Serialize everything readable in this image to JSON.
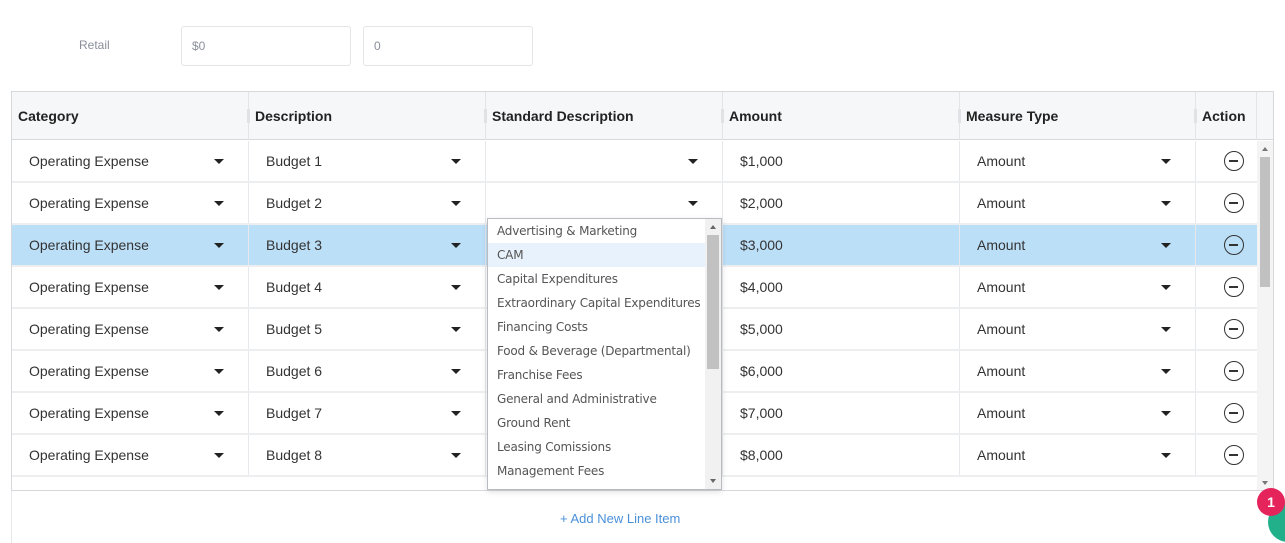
{
  "retail": {
    "label": "Retail",
    "amount_value": "$0",
    "count_value": "0"
  },
  "grid": {
    "headers": {
      "category": "Category",
      "description": "Description",
      "standard_description": "Standard Description",
      "amount": "Amount",
      "measure_type": "Measure Type",
      "action": "Action"
    },
    "rows": [
      {
        "category": "Operating Expense",
        "description": "Budget 1",
        "standard_description": "",
        "amount": "$1,000",
        "measure_type": "Amount"
      },
      {
        "category": "Operating Expense",
        "description": "Budget 2",
        "standard_description": "",
        "amount": "$2,000",
        "measure_type": "Amount"
      },
      {
        "category": "Operating Expense",
        "description": "Budget 3",
        "standard_description": "",
        "amount": "$3,000",
        "measure_type": "Amount"
      },
      {
        "category": "Operating Expense",
        "description": "Budget 4",
        "standard_description": "",
        "amount": "$4,000",
        "measure_type": "Amount"
      },
      {
        "category": "Operating Expense",
        "description": "Budget 5",
        "standard_description": "",
        "amount": "$5,000",
        "measure_type": "Amount"
      },
      {
        "category": "Operating Expense",
        "description": "Budget 6",
        "standard_description": "",
        "amount": "$6,000",
        "measure_type": "Amount"
      },
      {
        "category": "Operating Expense",
        "description": "Budget 7",
        "standard_description": "",
        "amount": "$7,000",
        "measure_type": "Amount"
      },
      {
        "category": "Operating Expense",
        "description": "Budget 8",
        "standard_description": "",
        "amount": "$8,000",
        "measure_type": "Amount"
      }
    ],
    "selected_row": 3
  },
  "dropdown": {
    "options": [
      "Advertising & Marketing",
      "CAM",
      "Capital Expenditures",
      "Extraordinary Capital Expenditures",
      "Financing Costs",
      "Food & Beverage (Departmental)",
      "Franchise Fees",
      "General and Administrative",
      "Ground Rent",
      "Leasing Comissions",
      "Management Fees"
    ],
    "hovered_option": "CAM"
  },
  "footer": {
    "add_line_label": "+ Add New Line Item"
  },
  "notification": {
    "count": "1"
  },
  "colors": {
    "selected_row": "#bcdff8",
    "link": "#4a90d9",
    "badge": "#e5245c",
    "chat_button": "#21b08a"
  },
  "icons": {
    "action": "minus-circle-icon",
    "dropdown_caret": "caret-down-icon"
  }
}
